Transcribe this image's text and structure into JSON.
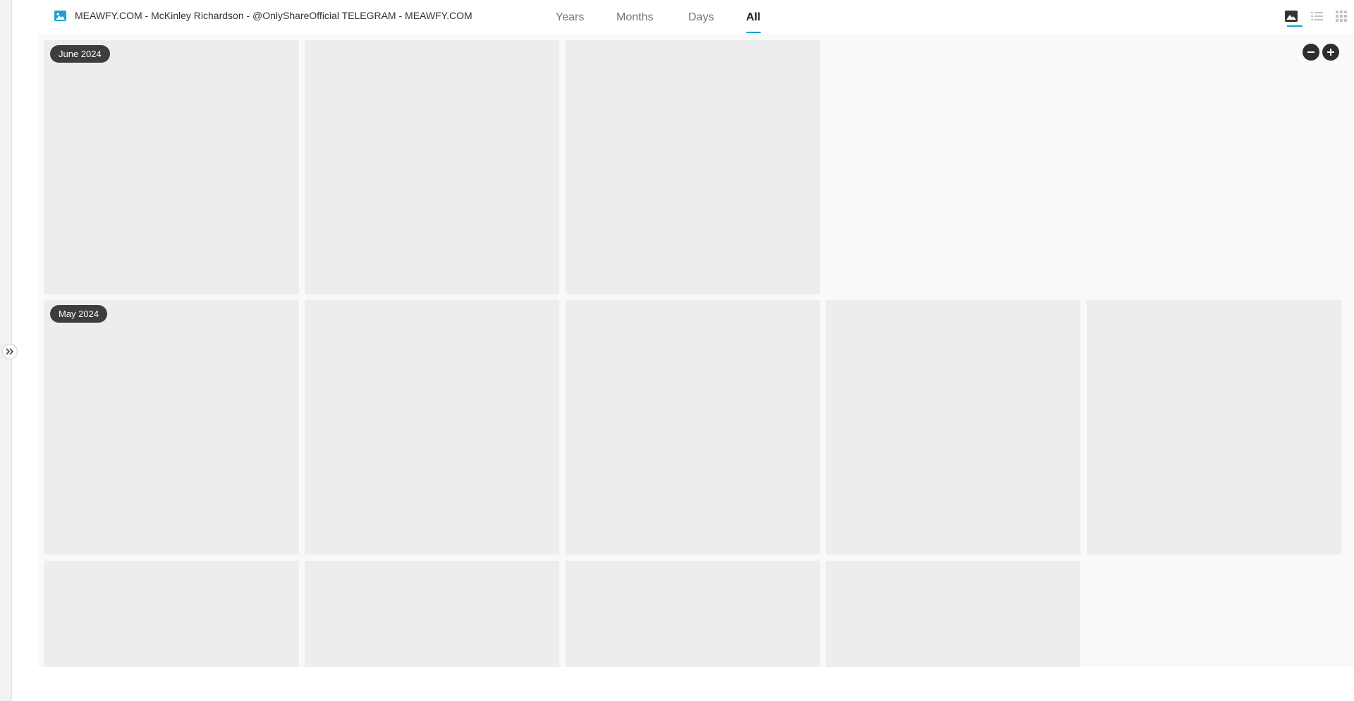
{
  "album": {
    "title": "MEAWFY.COM - McKinley Richardson - @OnlyShareOfficial TELEGRAM - MEAWFY.COM",
    "icon": "image-icon",
    "icon_color": "#1e9fd6"
  },
  "tabs": [
    {
      "label": "Years",
      "active": false
    },
    {
      "label": "Months",
      "active": false
    },
    {
      "label": "Days",
      "active": false
    },
    {
      "label": "All",
      "active": true
    }
  ],
  "view_modes": [
    {
      "icon": "photo-view-icon",
      "active": true
    },
    {
      "icon": "list-view-icon",
      "active": false
    },
    {
      "icon": "grid-view-icon",
      "active": false
    }
  ],
  "zoom": {
    "out_icon": "minus-icon",
    "in_icon": "plus-icon"
  },
  "sections": [
    {
      "label": "June 2024",
      "tiles": 3
    },
    {
      "label": "May 2024",
      "tiles": 9
    }
  ],
  "colors": {
    "accent": "#1e9fd6",
    "placeholder": "#ededed",
    "badge": "#3d3d3d"
  }
}
